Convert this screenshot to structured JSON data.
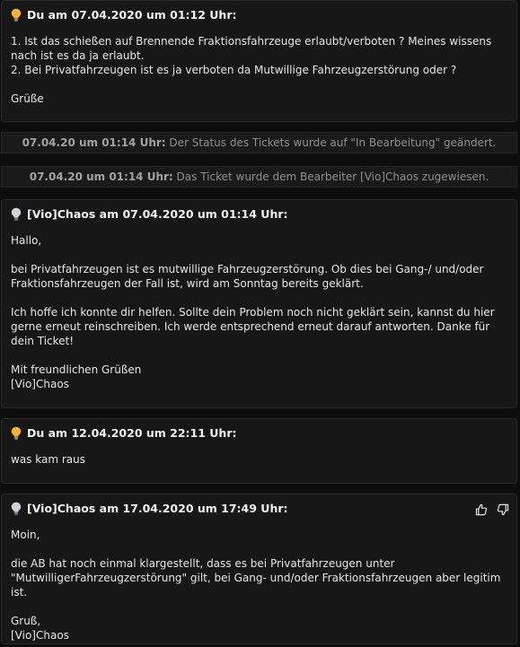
{
  "posts": [
    {
      "header": "Du am 07.04.2020 um 01:12 Uhr:",
      "lines": [
        "1. Ist das schießen auf Brennende Fraktionsfahrzeuge erlaubt/verboten ? Meines wissens nach ist es da ja erlaubt.",
        "2. Bei Privatfahrzeugen ist es ja verboten da Mutwillige Fahrzeugzerstörung oder ?",
        "",
        "Grüße"
      ]
    },
    {
      "header": "[Vio]Chaos am 07.04.2020 um 01:14 Uhr:",
      "lines": [
        "Hallo,",
        "",
        "bei Privatfahrzeugen ist es mutwillige Fahrzeugzerstörung. Ob dies bei Gang-/ und/oder Fraktionsfahrzeugen der Fall ist, wird am Sonntag bereits geklärt.",
        "",
        "Ich hoffe ich konnte dir helfen. Sollte dein Problem noch nicht geklärt sein, kannst du hier gerne erneut reinschreiben. Ich werde entsprechend erneut darauf antworten. Danke für dein Ticket!",
        "",
        "Mit freundlichen Grüßen",
        "[Vio]Chaos"
      ]
    },
    {
      "header": "Du am 12.04.2020 um 22:11 Uhr:",
      "lines": [
        "was kam raus"
      ]
    },
    {
      "header": "[Vio]Chaos am 17.04.2020 um 17:49 Uhr:",
      "lines": [
        "Moin,",
        "",
        "die AB hat noch einmal klargestellt, dass es bei Privatfahrzeugen unter \"MutwilligerFahrzeugzerstörung\" gilt, bei Gang- und/oder Fraktionsfahrzeugen aber legitim ist.",
        "",
        "Gruß,",
        "[Vio]Chaos"
      ]
    }
  ],
  "status_events": [
    {
      "timestamp": "07.04.20 um 01:14 Uhr:",
      "text": " Der Status des Tickets wurde auf \"In Bearbeitung\" geändert."
    },
    {
      "timestamp": "07.04.20 um 01:14 Uhr:",
      "text": " Das Ticket wurde dem Bearbeiter [Vio]Chaos zugewiesen."
    }
  ],
  "icons": {
    "author_icon": "lightbulb-icon",
    "like": "thumbs-up-icon",
    "dislike": "thumbs-down-icon"
  },
  "colors": {
    "bulb_user": "#f2b232",
    "bulb_staff": "#cfd3d9",
    "background": "#0d0d0d",
    "panel": "#171717"
  }
}
